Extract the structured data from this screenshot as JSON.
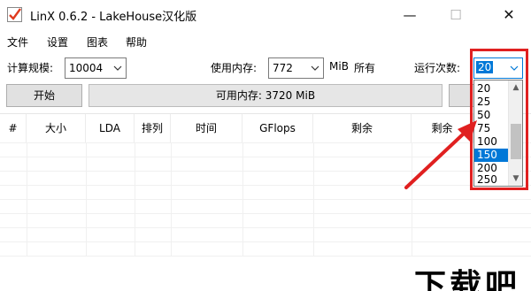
{
  "window": {
    "title": "LinX 0.6.2 - LakeHouse汉化版"
  },
  "menu": [
    "文件",
    "设置",
    "图表",
    "帮助"
  ],
  "controls": {
    "problem_size_label": "计算规模:",
    "problem_size_value": "10004",
    "memory_label": "使用内存:",
    "memory_value": "772",
    "memory_unit": "MiB",
    "memory_all": "所有",
    "runs_label": "运行次数:",
    "runs_value": "20"
  },
  "actions": {
    "start_label": "开始",
    "available_memory": "可用内存: 3720 MiB"
  },
  "table": {
    "columns": [
      "#",
      "大小",
      "LDA",
      "排列",
      "时间",
      "GFlops",
      "剩余",
      "剩余"
    ]
  },
  "dropdown": {
    "options": [
      "20",
      "25",
      "50",
      "75",
      "100",
      "150",
      "200",
      "250"
    ],
    "selected": "150"
  },
  "watermark": "下载吧",
  "colors": {
    "selection": "#0078d7",
    "annotation": "#e02020"
  }
}
